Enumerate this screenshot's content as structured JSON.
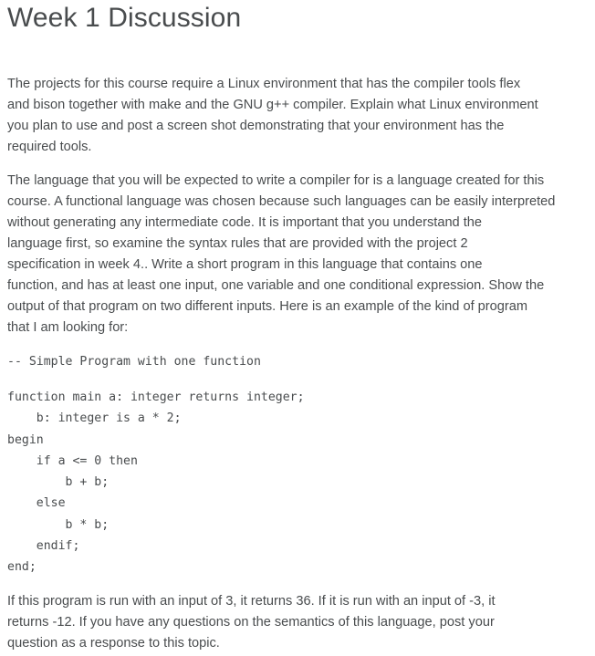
{
  "title": "Week 1 Discussion",
  "paragraph1": [
    "The projects for this course require a Linux environment that has the compiler tools flex",
    "and bison together with make and the GNU g++ compiler. Explain what Linux environment",
    "you plan to use and post a screen shot demonstrating that your environment has the",
    "required tools."
  ],
  "paragraph2": [
    "The language that you will be expected to write a compiler for is a language created for this",
    "course. A functional language was chosen because such languages can be easily interpreted",
    "without generating any intermediate code. It is important that you understand the",
    "language first, so examine the syntax rules that are provided with the project 2",
    "specification in week 4.. Write a short program in this language that contains one",
    "function, and has at least one input, one variable and one conditional expression. Show the",
    "output of that program on two different inputs. Here is an example of the kind of program",
    "that I am looking for:"
  ],
  "code_comment": "-- Simple Program with one function",
  "code": [
    "function main a: integer returns integer;",
    "    b: integer is a * 2;",
    "begin",
    "    if a <= 0 then",
    "        b + b;",
    "    else",
    "        b * b;",
    "    endif;",
    "end;"
  ],
  "paragraph3": [
    "If this program is run with an input of 3, it returns 36. If it is run with an input of -3, it",
    "returns -12. If you have any questions on the semantics of this language, post your",
    "question as a response to this topic."
  ]
}
